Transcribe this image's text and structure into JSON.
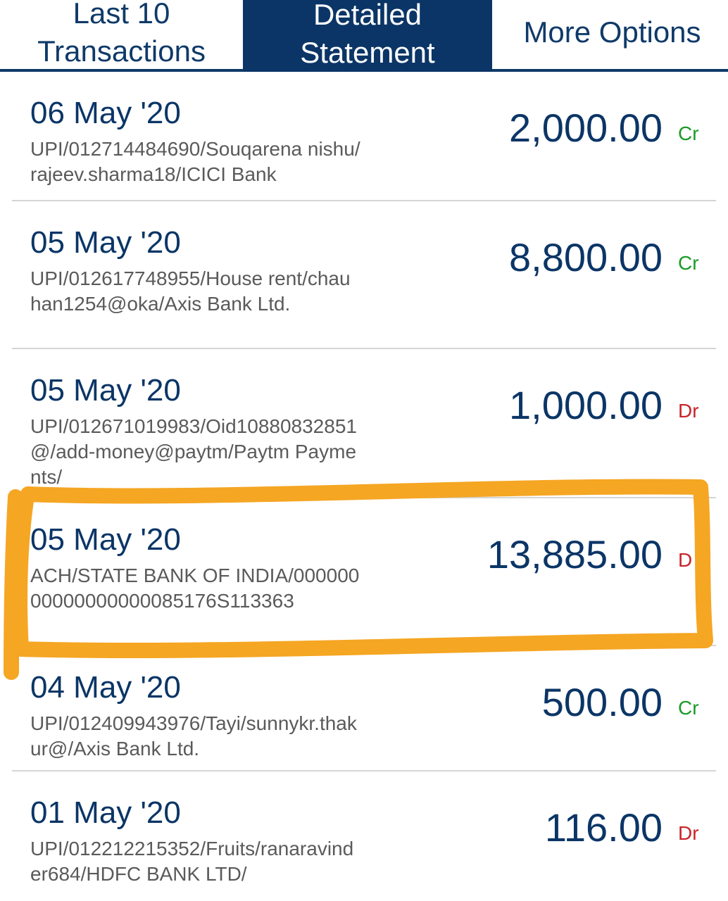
{
  "tabs": [
    {
      "label": "Last 10\nTransactions"
    },
    {
      "label": "Detailed\nStatement"
    },
    {
      "label": "More Options"
    }
  ],
  "transactions": [
    {
      "date": "06 May '20",
      "description": "UPI/012714484690/Souqarena nishu/rajeev.sharma18/ICICI Bank",
      "amount": "2,000.00",
      "type": "Cr"
    },
    {
      "date": "05 May '20",
      "description": "UPI/012617748955/House rent/chauhan1254@oka/Axis Bank Ltd.",
      "amount": "8,800.00",
      "type": "Cr"
    },
    {
      "date": "05 May '20",
      "description": "UPI/012671019983/Oid10880832851@/add-money@paytm/Paytm Payments/",
      "amount": "1,000.00",
      "type": "Dr"
    },
    {
      "date": "05 May '20",
      "description": "ACH/STATE BANK OF INDIA/00000000000000000085176S113363",
      "amount": "13,885.00",
      "type": "D"
    },
    {
      "date": "04 May '20",
      "description": "UPI/012409943976/Tayi/sunnykr.thakur@/Axis Bank Ltd.",
      "amount": "500.00",
      "type": "Cr"
    },
    {
      "date": "01 May '20",
      "description": "UPI/012212215352/Fruits/ranaravinder684/HDFC BANK LTD/",
      "amount": "116.00",
      "type": "Dr"
    }
  ],
  "colors": {
    "navy": "#0b3566",
    "credit": "#1a9a26",
    "debit": "#c8242a",
    "highlight": "#f5a623"
  }
}
